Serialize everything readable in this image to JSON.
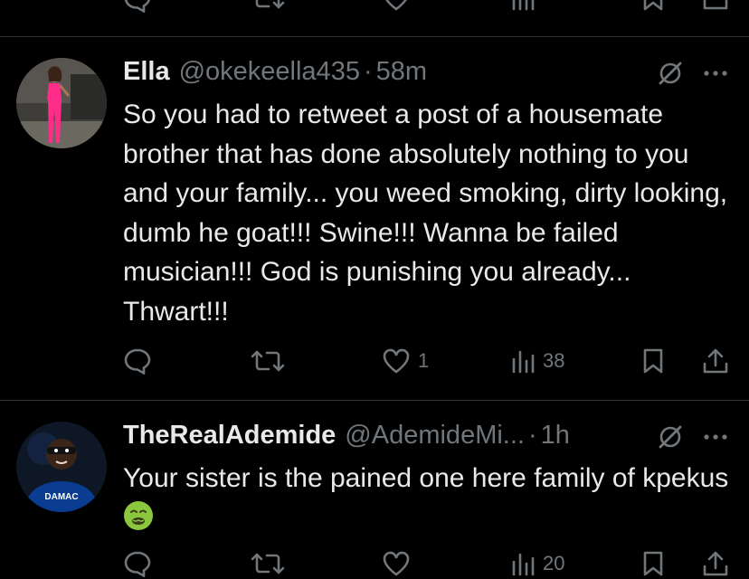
{
  "tweets": [
    {
      "display_name": "Ella",
      "handle": "@okekeella435",
      "separator": "·",
      "time": "58m",
      "text": "So you had to retweet a post of a housemate brother that has done absolutely nothing to you and your family... you weed smoking, dirty looking, dumb he goat!!! Swine!!! Wanna be failed musician!!! God is punishing you already... Thwart!!!",
      "replies": "",
      "retweets": "",
      "likes": "1",
      "views": "38"
    },
    {
      "display_name": "TheRealAdemide",
      "handle": "@AdemideMi...",
      "separator": "·",
      "time": "1h",
      "text": "Your sister is the pained one here family of kpekus",
      "emoji": "nauseated-face-emoji",
      "replies": "",
      "retweets": "",
      "likes": "",
      "views": "20"
    }
  ],
  "icons": {
    "reply": "reply-icon",
    "retweet": "retweet-icon",
    "like": "heart-icon",
    "views": "views-icon",
    "bookmark": "bookmark-icon",
    "share": "share-icon",
    "grok": "grok-icon",
    "more": "more-icon"
  },
  "colors": {
    "background": "#000000",
    "text": "#e7e9ea",
    "secondary": "#71767b",
    "divider": "#2f3336",
    "jersey": "#0a3d91",
    "dress": "#ff2d8a"
  }
}
